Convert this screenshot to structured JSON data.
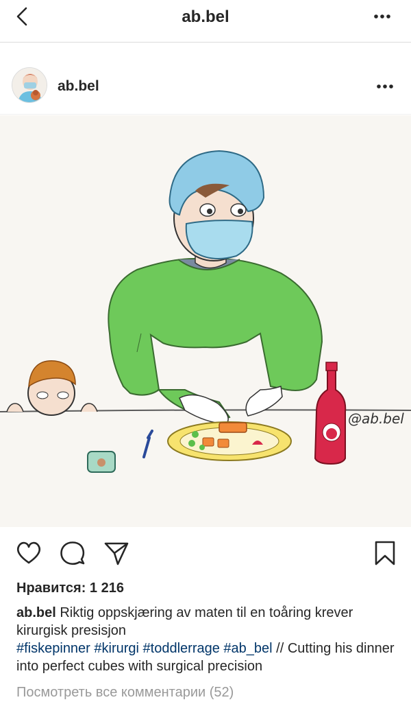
{
  "topbar": {
    "title": "ab.bel"
  },
  "post": {
    "username": "ab.bel",
    "image_watermark": "@ab.bel",
    "likes_text": "Нравится: 1 216",
    "caption": {
      "user": "ab.bel",
      "text_1": " Riktig oppskjæring av maten til en toåring krever kirurgisk presisjon",
      "tags": [
        {
          "text": "#fiskepinner"
        },
        {
          "text": "#kirurgi"
        },
        {
          "text": "#toddlerrage"
        },
        {
          "text": "#ab_bel"
        }
      ],
      "text_2": " // Cutting his dinner into perfect cubes with surgical precision"
    },
    "comments_link": "Посмотреть все комментарии (52)"
  },
  "colors": {
    "hashtag": "#003569",
    "muted": "#999999",
    "text": "#262626"
  },
  "icons": [
    "back-arrow-icon",
    "more-dots-icon",
    "heart-icon",
    "comment-icon",
    "share-icon",
    "bookmark-icon"
  ]
}
